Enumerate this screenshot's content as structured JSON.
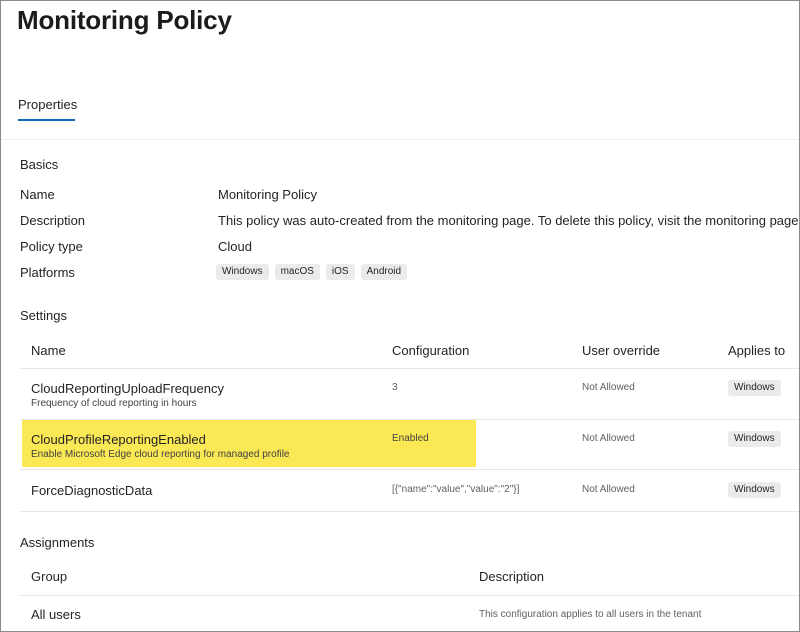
{
  "page": {
    "title": "Monitoring Policy"
  },
  "tabs": [
    {
      "label": "Properties",
      "active": true
    }
  ],
  "basics": {
    "heading": "Basics",
    "rows": [
      {
        "label": "Name",
        "value": "Monitoring Policy"
      },
      {
        "label": "Description",
        "value": "This policy was auto-created from the monitoring page. To delete this policy, visit the monitoring page."
      },
      {
        "label": "Policy type",
        "value": "Cloud"
      },
      {
        "label": "Platforms",
        "chips": [
          "Windows",
          "macOS",
          "iOS",
          "Android"
        ]
      }
    ]
  },
  "settings": {
    "heading": "Settings",
    "columns": [
      "Name",
      "Configuration",
      "User override",
      "Applies to"
    ],
    "rows": [
      {
        "name": "CloudReportingUploadFrequency",
        "description": "Frequency of cloud reporting in hours",
        "configuration": "3",
        "user_override": "Not Allowed",
        "applies_to": "Windows",
        "highlighted": false
      },
      {
        "name": "CloudProfileReportingEnabled",
        "description": "Enable Microsoft Edge cloud reporting for managed profile",
        "configuration": "Enabled",
        "user_override": "Not Allowed",
        "applies_to": "Windows",
        "highlighted": true
      },
      {
        "name": "ForceDiagnosticData",
        "description": "",
        "configuration": "[{\"name\":\"value\",\"value\":\"2\"}]",
        "user_override": "Not Allowed",
        "applies_to": "Windows",
        "highlighted": false
      }
    ]
  },
  "assignments": {
    "heading": "Assignments",
    "columns": [
      "Group",
      "Description"
    ],
    "rows": [
      {
        "group": "All users",
        "description": "This configuration applies to all users in the tenant"
      }
    ]
  },
  "colors": {
    "accent": "#0f6cbd",
    "highlight": "#fbe855",
    "chip_bg": "#ebebeb"
  }
}
